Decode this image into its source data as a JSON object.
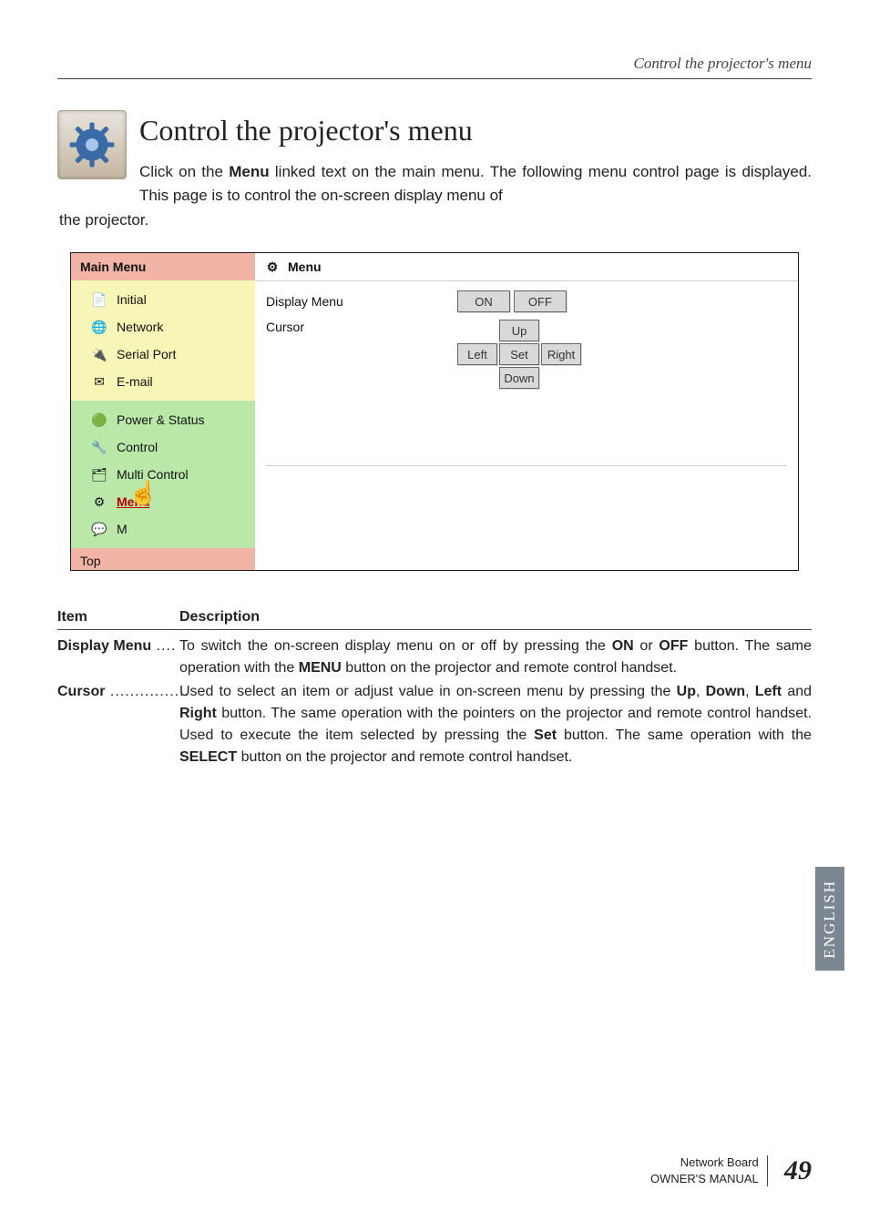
{
  "running_header": "Control the projector's menu",
  "heading": "Control the projector's menu",
  "intro_parts": {
    "before_bold": "Click on the ",
    "bold": "Menu",
    "after_bold": " linked text on the main menu. The following menu control page is displayed. This page is to control the on-screen display menu of",
    "cont": "the projector."
  },
  "sidebar": {
    "header": "Main Menu",
    "groups": [
      {
        "class": "yellow",
        "items": [
          {
            "label": "Initial",
            "glyph": "📄"
          },
          {
            "label": "Network",
            "glyph": "🌐"
          },
          {
            "label": "Serial Port",
            "glyph": "🔌"
          },
          {
            "label": "E-mail",
            "glyph": "✉"
          }
        ]
      },
      {
        "class": "green",
        "items": [
          {
            "label": "Power & Status",
            "glyph": "🟢"
          },
          {
            "label": "Control",
            "glyph": "🔧"
          },
          {
            "label": "Multi Control",
            "glyph": "🗂"
          },
          {
            "label": "Menu",
            "glyph": "⚙",
            "active": true
          },
          {
            "label": "M",
            "glyph": "💬"
          }
        ]
      }
    ],
    "footer": "Top"
  },
  "content": {
    "header": "Menu",
    "rows": {
      "display_menu": {
        "label": "Display Menu",
        "buttons": [
          "ON",
          "OFF"
        ]
      },
      "cursor": {
        "label": "Cursor",
        "buttons": {
          "up": "Up",
          "left": "Left",
          "set": "Set",
          "right": "Right",
          "down": "Down"
        }
      }
    }
  },
  "desc": {
    "headers": {
      "item": "Item",
      "description": "Description"
    },
    "rows": [
      {
        "item": "Display Menu",
        "dots": " ....",
        "text": "To switch the on-screen display menu on or off by pressing the <b>ON</b> or <b>OFF</b> button. The same operation with the <b>MENU</b> button on the projector and remote control handset."
      },
      {
        "item": "Cursor",
        "dots": " ................",
        "text": "Used to select an item or adjust value in on-screen menu by pressing the <b>Up</b>, <b>Down</b>, <b>Left</b> and <b>Right</b> button. The same operation with the pointers on the projector and remote control handset. Used to execute the item selected by pressing the <b>Set</b> button. The same operation with the <b>SELECT</b> button on the projector and remote control handset."
      }
    ]
  },
  "lang_tab": "ENGLISH",
  "footer": {
    "line1": "Network Board",
    "line2": "OWNER'S MANUAL",
    "page": "49"
  }
}
